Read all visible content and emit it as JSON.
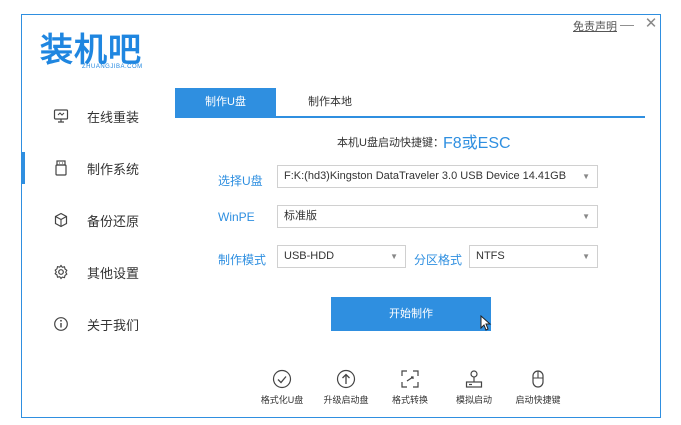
{
  "brand": {
    "logo_text": "装机吧",
    "logo_subtitle": "ZHUANGJIBA.COM",
    "color": "#2f8fe0"
  },
  "header": {
    "disclaimer": "免责声明",
    "minimize": "—",
    "close": "✕"
  },
  "sidebar": {
    "items": [
      {
        "label": "在线重装",
        "icon": "monitor-icon",
        "active": false
      },
      {
        "label": "制作系统",
        "icon": "usb-drive-icon",
        "active": true
      },
      {
        "label": "备份还原",
        "icon": "backup-cube-icon",
        "active": false
      },
      {
        "label": "其他设置",
        "icon": "gear-icon",
        "active": false
      },
      {
        "label": "关于我们",
        "icon": "info-icon",
        "active": false
      }
    ]
  },
  "tabs": [
    {
      "label": "制作U盘",
      "active": true
    },
    {
      "label": "制作本地",
      "active": false
    }
  ],
  "hotkey": {
    "label": "本机U盘启动快捷键：",
    "value": "F8或ESC"
  },
  "form": {
    "usb_label": "选择U盘",
    "usb_value": "F:K:(hd3)Kingston DataTraveler 3.0 USB Device 14.41GB",
    "winpe_label": "WinPE",
    "winpe_value": "标准版",
    "mode_label": "制作模式",
    "mode_value": "USB-HDD",
    "partition_label": "分区格式",
    "partition_value": "NTFS"
  },
  "start_button": "开始制作",
  "tools": [
    {
      "label": "格式化U盘",
      "icon": "check-circle-icon"
    },
    {
      "label": "升级启动盘",
      "icon": "upload-circle-icon"
    },
    {
      "label": "格式转换",
      "icon": "convert-icon"
    },
    {
      "label": "模拟启动",
      "icon": "simulate-icon"
    },
    {
      "label": "启动快捷键",
      "icon": "mouse-icon"
    }
  ]
}
